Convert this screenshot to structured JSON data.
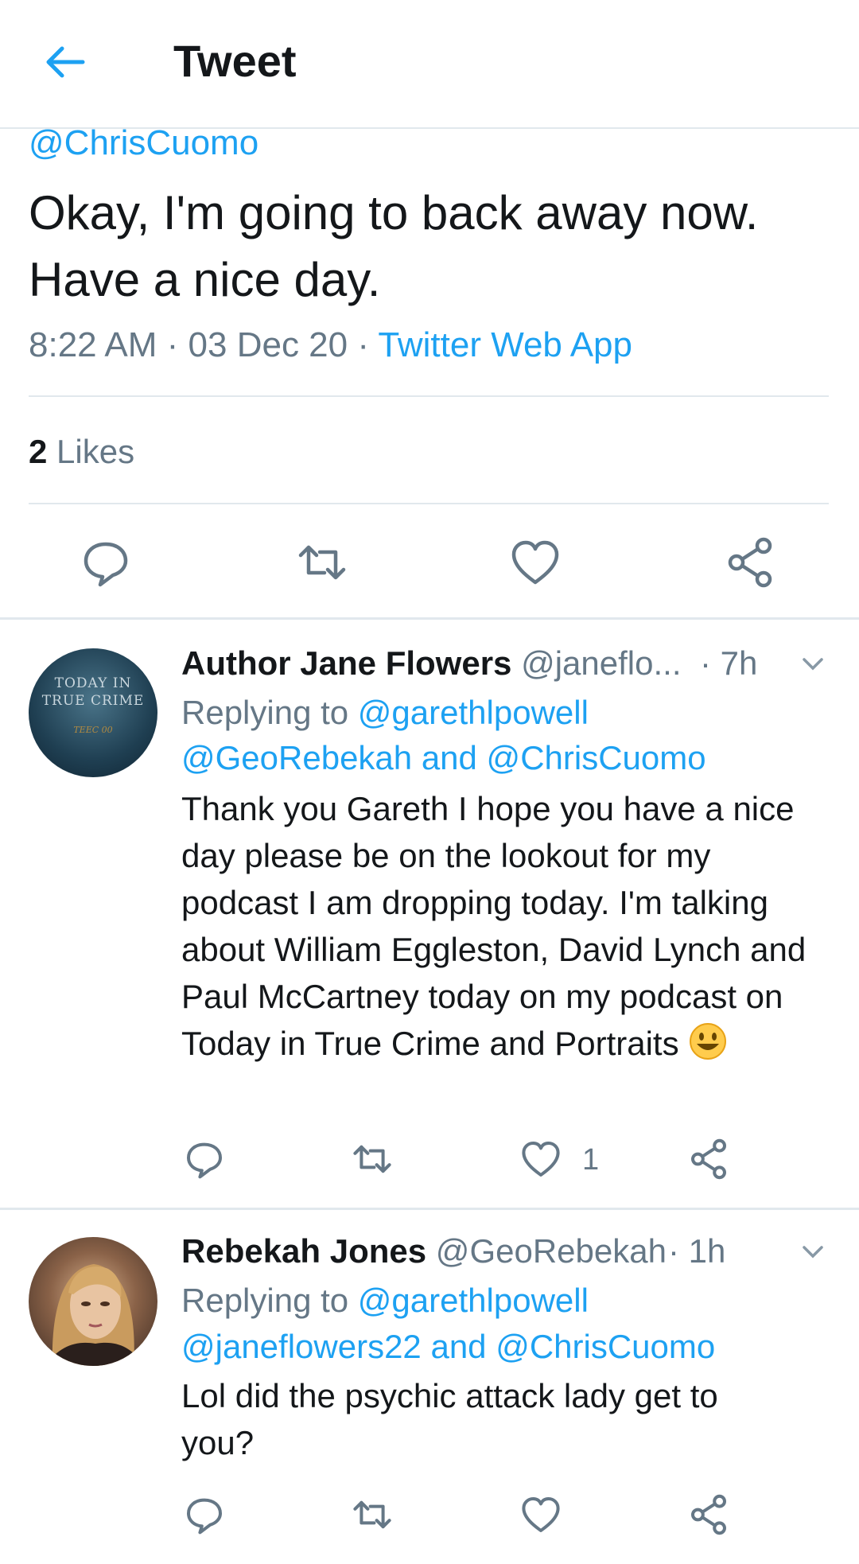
{
  "header": {
    "title": "Tweet",
    "back_icon": "arrow-left-icon"
  },
  "main_tweet": {
    "mention": "@ChrisCuomo",
    "text": "Okay, I'm going to back away now. Have a nice day.",
    "time": "8:22 AM · 03 Dec 20 · ",
    "source": "Twitter Web App",
    "likes_count": "2",
    "likes_label": " Likes",
    "actions": [
      "reply-icon",
      "retweet-icon",
      "like-icon",
      "share-icon"
    ]
  },
  "replies": [
    {
      "name": "Author Jane Flowers",
      "handle": " @janeflo...",
      "time": "· 7h",
      "replying_prefix": "Replying to ",
      "replying_to_1": "@garethlpowell",
      "replying_to_2": "@GeoRebekah and @ChrisCuomo",
      "text": "Thank you Gareth I hope you have a nice day please be on the lookout for my podcast I am dropping today. I'm talking about William Eggleston, David Lynch and Paul McCartney today on my podcast on Today in True Crime and Portraits",
      "avatar_text": [
        "TODAY IN",
        "TRUE CRIME",
        "TEEC 00"
      ],
      "like_count": "1"
    },
    {
      "name": "Rebekah Jones",
      "handle": " @GeoRebekah",
      "time": "· 1h",
      "replying_prefix": "Replying to ",
      "replying_to_1": "@garethlpowell",
      "replying_to_2": "@janeflowers22 and @ChrisCuomo",
      "text": "Lol did the psychic attack lady get to you?",
      "like_count": ""
    }
  ],
  "colors": {
    "accent": "#1da1f2",
    "secondary": "#657786",
    "divider": "#e1e8ed",
    "text": "#14171a"
  }
}
